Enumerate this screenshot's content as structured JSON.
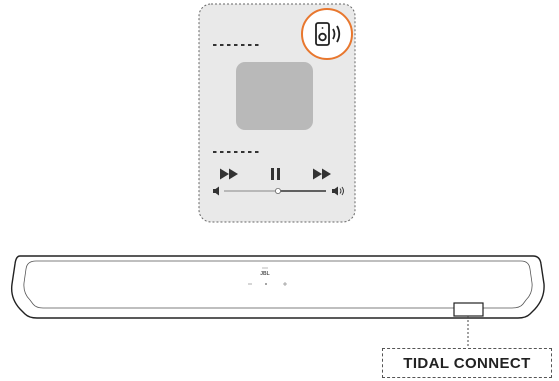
{
  "soundbar": {
    "brand_text": "JBL"
  },
  "feature": {
    "label": "TIDAL CONNECT"
  },
  "colors": {
    "accent": "#e8772e",
    "phone_fill": "#e9e9e9",
    "line": "#333333"
  },
  "icons": {
    "cast": "speaker-cast-icon",
    "rewind": "rewind-icon",
    "pause": "pause-icon",
    "forward": "fast-forward-icon",
    "volume_low": "volume-low-icon",
    "volume_high": "volume-high-icon"
  }
}
